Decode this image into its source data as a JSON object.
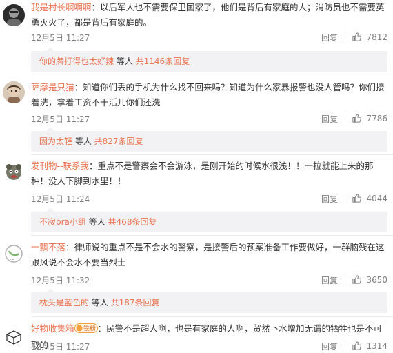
{
  "comments": [
    {
      "username": "我是村长啊啊啊",
      "text": "：以后军人也不需要保卫国家了，他们是背后有家庭的人；消防员也不需要英勇灭火了，都是背后有家庭的。",
      "time": "12月5日 11:27",
      "reply_label": "回复",
      "likes": "7812",
      "sub": {
        "user": "你的牌打得也太好辣",
        "rest": " 等人 ",
        "count": "共1146条回复"
      }
    },
    {
      "username": "萨摩是只猫",
      "text": "：知道你们丢的手机为什么找不回来吗？知道为什么家暴报警也没人管吗？你们接着洗，拿着工资不干活儿你们还洗",
      "time": "12月5日 11:27",
      "reply_label": "回复",
      "likes": "7786",
      "sub": {
        "user": "因为太轻",
        "rest": " 等人 ",
        "count": "共827条回复"
      }
    },
    {
      "username": "发刊物--联系我",
      "text": "：重点不是警察会不会游泳，是刚开始的时候水很浅！！一拉就能上来的那种！没人下脚到水里！！",
      "time": "12月5日 11:24",
      "reply_label": "回复",
      "likes": "4044",
      "sub": {
        "user": "不寂bra小组",
        "rest": " 等人 ",
        "count": "共468条回复"
      }
    },
    {
      "username": "一飘不落",
      "text": "：律师说的重点不是不会水的警察，是接警后的预案准备工作要做好，一群脑残在这跟风说不会水不要当烈士",
      "time": "12月5日 11:32",
      "reply_label": "回复",
      "likes": "3650",
      "sub": {
        "user": "枕头是蓝色的",
        "rest": " 等人 ",
        "count": "共187条回复"
      }
    },
    {
      "username": "好物收集箱",
      "badge": "铁粉",
      "text": "：民警不是超人啊，也是有家庭的人啊，贸然下水增加无谓的牺牲也是不可取的",
      "time": "12月5日 11:27",
      "reply_label": "回复",
      "likes": "1314"
    }
  ],
  "colors": {
    "link": "#eb7350",
    "meta": "#808080",
    "sub_bg": "#f2f2f5"
  },
  "icons": {
    "like": "thumbs-up-icon",
    "badge": "fan-badge-icon"
  }
}
